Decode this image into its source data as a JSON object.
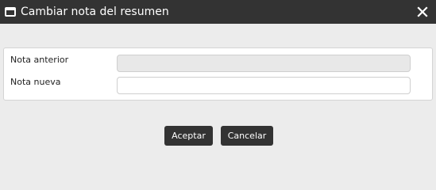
{
  "dialog": {
    "title": "Cambiar nota del resumen",
    "window_icon": "window-icon",
    "close_icon": "close-icon"
  },
  "form": {
    "previous_note": {
      "label": "Nota anterior",
      "value": ""
    },
    "new_note": {
      "label": "Nota nueva",
      "value": ""
    }
  },
  "buttons": {
    "accept_label": "Aceptar",
    "cancel_label": "Cancelar"
  },
  "colors": {
    "titlebar": "#333333",
    "background": "#ececec",
    "button": "#333333",
    "disabled_field": "#e8e8e8"
  }
}
